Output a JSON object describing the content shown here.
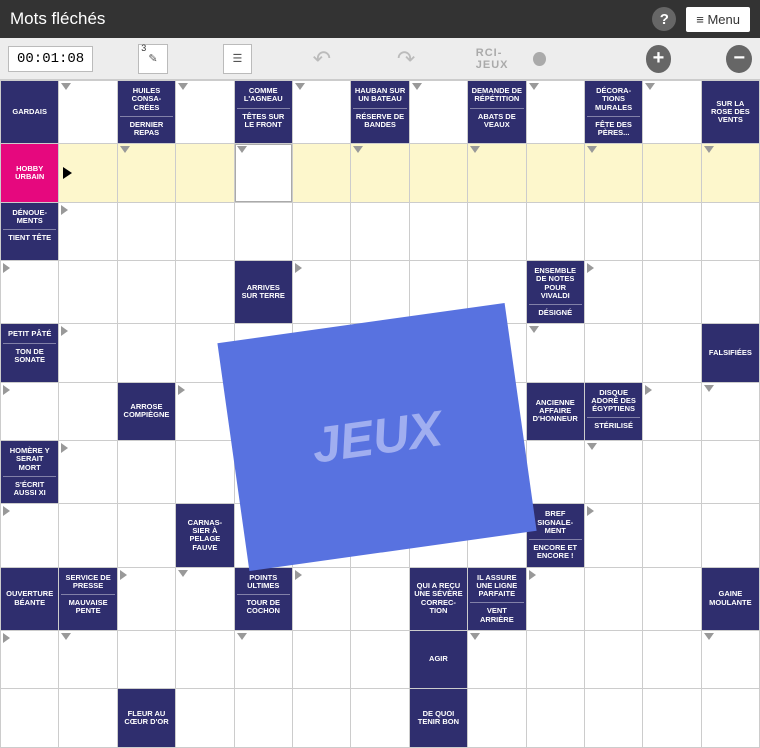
{
  "header": {
    "title": "Mots fléchés",
    "menu": "≡ Menu"
  },
  "toolbar": {
    "timer": "00:01:08",
    "hint_count": "3",
    "logo": "RCI-JEUX",
    "plus": "+",
    "minus": "−"
  },
  "overlay": {
    "text": "JEUX"
  },
  "clues": {
    "r0c0": "GARDAIS",
    "r0c2a": "HUILES CONSA-CRÉES",
    "r0c2b": "DERNIER REPAS",
    "r0c4a": "COMME L'AGNEAU",
    "r0c4b": "TÊTES SUR LE FRONT",
    "r0c6a": "HAUBAN SUR UN BATEAU",
    "r0c6b": "RÉSERVE DE BANDES",
    "r0c8a": "DEMANDE DE RÉPÉTITION",
    "r0c8b": "ABATS DE VEAUX",
    "r0c10a": "DÉCORA-TIONS MURALES",
    "r0c10b": "FÊTE DES PÈRES...",
    "r0c12": "SUR LA ROSE DES VENTS",
    "r1c0": "HOBBY URBAIN",
    "r2c0a": "DÉNOUE-MENTS",
    "r2c0b": "TIENT TÊTE",
    "r3c4": "ARRIVES SUR TERRE",
    "r3c9a": "ENSEMBLE DE NOTES POUR VIVALDI",
    "r3c9b": "DÉSIGNÉ",
    "r4c0a": "PETIT PÂTÉ",
    "r4c0b": "TON DE SONATE",
    "r4c12": "FALSIFIÉES",
    "r5c2": "ARROSE COMPIÈGNE",
    "r5c9": "ANCIENNE AFFAIRE D'HONNEUR",
    "r5c10a": "DISQUE ADORÉ DES ÉGYPTIENS",
    "r5c10b": "STÉRILISÉ",
    "r6c0a": "HOMÈRE Y SERAIT MORT",
    "r6c0b": "S'ÉCRIT AUSSI XI",
    "r7c3": "CARNAS-SIER À PELAGE FAUVE",
    "r7c9a": "BREF SIGNALE-MENT",
    "r7c9b": "ENCORE ET ENCORE !",
    "r8c0": "OUVERTURE BÉANTE",
    "r8c1a": "SERVICE DE PRESSE",
    "r8c1b": "MAUVAISE PENTE",
    "r8c4a": "POINTS ULTIMES",
    "r8c4b": "TOUR DE COCHON",
    "r8c7": "QUI A REÇU UNE SÉVÈRE CORREC-TION",
    "r8c8a": "IL ASSURE UNE LIGNE PARFAITE",
    "r8c8b": "VENT ARRIÈRE",
    "r8c12": "GAINE MOULANTE",
    "r9c7": "AGIR",
    "r10c2": "FLEUR AU CŒUR D'OR",
    "r10c7": "DE QUOI TENIR BON"
  }
}
